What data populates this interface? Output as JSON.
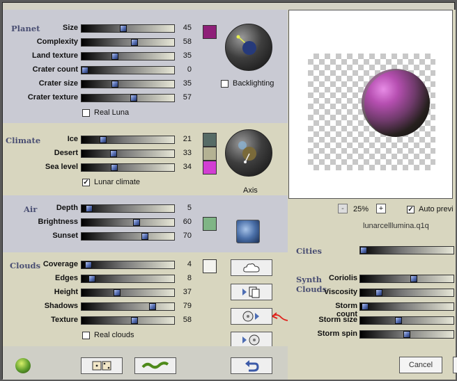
{
  "planet": {
    "title": "Planet",
    "sliders": [
      {
        "label": "Size",
        "value": 45
      },
      {
        "label": "Complexity",
        "value": 58
      },
      {
        "label": "Land texture",
        "value": 35
      },
      {
        "label": "Crater count",
        "value": 0
      },
      {
        "label": "Crater size",
        "value": 35
      },
      {
        "label": "Crater texture",
        "value": 57
      }
    ],
    "swatch_color": "#8e1f78",
    "backlighting_label": "Backlighting",
    "backlighting_checked": false,
    "real_luna_label": "Real Luna",
    "real_luna_checked": false
  },
  "climate": {
    "title": "Climate",
    "sliders": [
      {
        "label": "Ice",
        "value": 21
      },
      {
        "label": "Desert",
        "value": 33
      },
      {
        "label": "Sea level",
        "value": 34
      }
    ],
    "swatches": [
      "#566b66",
      "#b4b293",
      "#d23ed3"
    ],
    "lunar_climate_label": "Lunar climate",
    "lunar_climate_checked": true,
    "axis_label": "Axis"
  },
  "air": {
    "title": "Air",
    "sliders": [
      {
        "label": "Depth",
        "value": 5
      },
      {
        "label": "Brightness",
        "value": 60
      },
      {
        "label": "Sunset",
        "value": 70
      }
    ],
    "swatch_color": "#7fb585"
  },
  "clouds": {
    "title": "Clouds",
    "sliders": [
      {
        "label": "Coverage",
        "value": 4
      },
      {
        "label": "Edges",
        "value": 8
      },
      {
        "label": "Height",
        "value": 37
      },
      {
        "label": "Shadows",
        "value": 79
      },
      {
        "label": "Texture",
        "value": 58
      }
    ],
    "swatch_color": "#f3f3ee",
    "real_clouds_label": "Real clouds",
    "real_clouds_checked": false
  },
  "preview": {
    "zoom": "25%",
    "zoom_minus": "-",
    "zoom_plus": "+",
    "auto_preview_label": "Auto previ",
    "auto_preview_checked": true,
    "filename": "lunarcelllumina.q1q"
  },
  "cities": {
    "label": "Cities",
    "value": 0
  },
  "synth_clouds": {
    "title": "Synth Clouds",
    "sliders": [
      {
        "label": "Coriolis",
        "value": 58
      },
      {
        "label": "Viscosity",
        "value": 18
      },
      {
        "label": "Storm count",
        "value": 2
      },
      {
        "label": "Storm size",
        "value": 40
      },
      {
        "label": "Storm spin",
        "value": 50
      }
    ]
  },
  "buttons": {
    "cancel": "Cancel"
  },
  "icons": {
    "cloud": "cloud-icon",
    "copy": "copy-icon",
    "disk_load": "disk-load-icon",
    "disk_save": "disk-save-icon",
    "undo": "undo-icon",
    "dice": "dice-icon",
    "wave": "wave-icon",
    "app": "app-logo-icon",
    "globe": "globe-icon"
  },
  "annotation_color": "#e0201a"
}
